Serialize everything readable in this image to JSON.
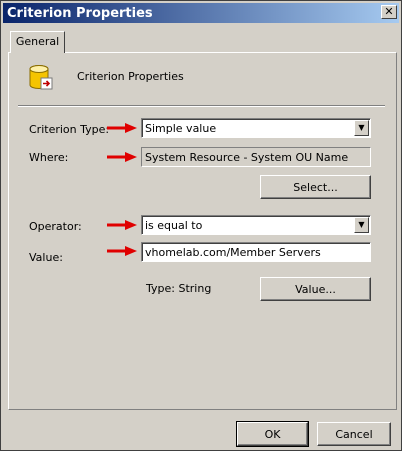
{
  "window": {
    "title": "Criterion Properties",
    "close_glyph": "✕"
  },
  "tabs": [
    {
      "label": "General"
    }
  ],
  "header": {
    "icon": "criterion-database-icon",
    "title": "Criterion Properties"
  },
  "form": {
    "criterion_type": {
      "label": "Criterion Type:",
      "value": "Simple value"
    },
    "where": {
      "label": "Where:",
      "value": "System Resource - System OU Name"
    },
    "select_button": "Select...",
    "operator": {
      "label": "Operator:",
      "value": "is equal to"
    },
    "value": {
      "label": "Value:",
      "value": "vhomelab.com/Member Servers"
    },
    "type_text": "Type: String",
    "value_button": "Value..."
  },
  "footer": {
    "ok": "OK",
    "cancel": "Cancel"
  },
  "colors": {
    "arrow": "#e00000",
    "titlebar_start": "#0a246a",
    "titlebar_end": "#a6caf0"
  }
}
